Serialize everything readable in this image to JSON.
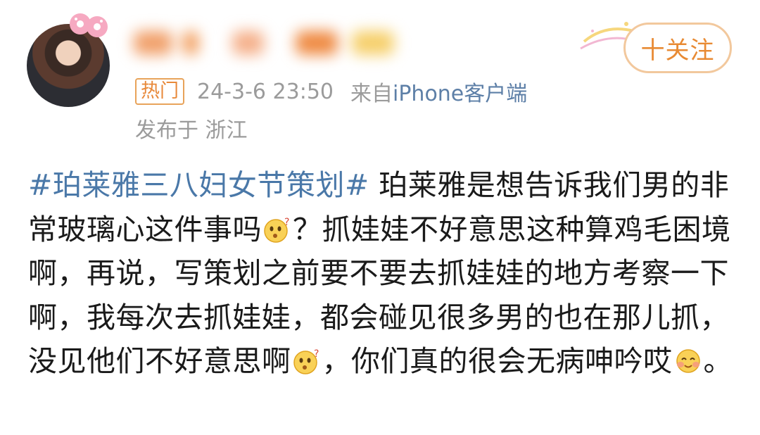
{
  "post": {
    "badge": "热门",
    "time": "24-3-6 23:50",
    "source_prefix": "来自 ",
    "source_app": "iPhone客户端",
    "location": "发布于 浙江",
    "follow_label": "十关注",
    "hashtag": "#珀莱雅三八妇女节策划#",
    "text_1": " 珀莱雅是想告诉我们男的非常玻璃心这件事吗",
    "text_2": "？抓娃娃不好意思这种算鸡毛困境啊，再说，写策划之前要不要去抓娃娃的地方考察一下啊，我每次去抓娃娃，都会碰见很多男的也在那儿抓，没见他们不好意思啊",
    "text_3": "，你们真的很会无病呻吟哎",
    "text_4": "。"
  },
  "icons": [
    "avatar",
    "donut-badge-icon",
    "follow-decoration-icon",
    "thinking-face-emoji",
    "blush-face-emoji"
  ],
  "colors": {
    "accent": "#e88a33",
    "link": "#4a78a8",
    "meta": "#9b9b9b",
    "source": "#5d7fa7"
  }
}
